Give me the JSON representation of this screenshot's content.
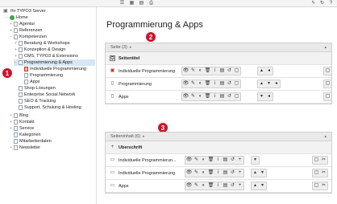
{
  "toolbar": {
    "left_icons": [
      "list-icon",
      "calendar-icon",
      "document-icon",
      "print-icon"
    ],
    "right_icons": [
      "flash-icon",
      "refresh-icon",
      "help-icon"
    ]
  },
  "tree": {
    "root": "Ihr TYPO3 Server",
    "home": "Home",
    "items": [
      {
        "label": "Agentur"
      },
      {
        "label": "Referenzen"
      },
      {
        "label": "Kompetenzen"
      },
      {
        "label": "Beratung & Workshops"
      },
      {
        "label": "Konzeption & Design"
      },
      {
        "label": "CMS, TYPO3 & Extensions"
      },
      {
        "label": "Programmierung & Apps"
      },
      {
        "label": "Individuelle Programmierung"
      },
      {
        "label": "Programmierung"
      },
      {
        "label": "Apps"
      },
      {
        "label": "Shop-Lösungen"
      },
      {
        "label": "Enterprise Social Network"
      },
      {
        "label": "SEO & Tracking"
      },
      {
        "label": "Support, Schulung & Hosting"
      },
      {
        "label": "Blog"
      },
      {
        "label": "Kontakt"
      },
      {
        "label": "Service"
      },
      {
        "label": "Kategorien"
      },
      {
        "label": "Mitarbeiterdaten"
      },
      {
        "label": "Newsletter"
      }
    ]
  },
  "badges": [
    "1",
    "2",
    "3"
  ],
  "main": {
    "title": "Programmierung & Apps",
    "panel1": {
      "header": "Seite (3)",
      "column": "Seitentitel",
      "rows": [
        "Individuelle Programmierung",
        "Programmierung",
        "Apps"
      ]
    },
    "panel2": {
      "header": "Seiteninhalt (6)",
      "column": "Überschrift",
      "rows": [
        "Individuelle Programmierun...",
        "Individuelle Programmierung",
        "Apps"
      ]
    }
  },
  "colors": {
    "badge": "#c6162d",
    "selected": "#d8e6f3"
  }
}
